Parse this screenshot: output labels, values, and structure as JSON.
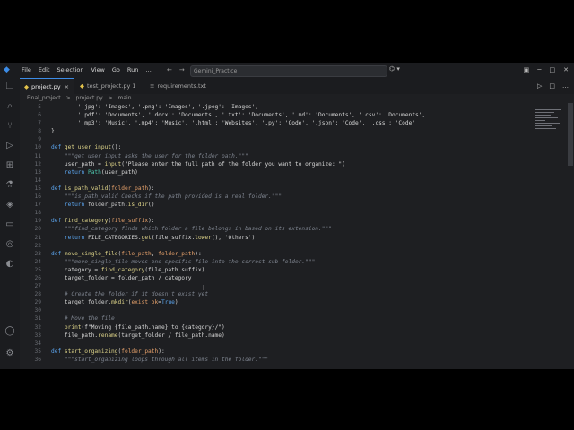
{
  "menu": [
    "File",
    "Edit",
    "Selection",
    "View",
    "Go",
    "Run",
    "…"
  ],
  "search": {
    "value": "Gemini_Practice"
  },
  "tabs": [
    {
      "label": "project.py",
      "active": true,
      "close": "×"
    },
    {
      "label": "test_project.py 1",
      "active": false,
      "close": ""
    },
    {
      "label": "requirements.txt",
      "active": false,
      "close": ""
    }
  ],
  "breadcrumbs": [
    "Final_project",
    ">",
    "project.py",
    ">",
    "main"
  ],
  "lines": [
    {
      "n": "5",
      "tokens": [
        {
          "t": "        "
        },
        {
          "t": "'.jpg': 'Images', '.png': 'Images', '.jpeg': 'Images',",
          "c": "st"
        }
      ]
    },
    {
      "n": "6",
      "tokens": [
        {
          "t": "        "
        },
        {
          "t": "'.pdf': 'Documents', '.docx': 'Documents', '.txt': 'Documents', '.md': 'Documents', '.csv': 'Documents',",
          "c": "st"
        }
      ]
    },
    {
      "n": "7",
      "tokens": [
        {
          "t": "        "
        },
        {
          "t": "'.mp3': 'Music', '.mp4': 'Music', '.html': 'Websites', '.py': 'Code', '.json': 'Code', '.css': 'Code'",
          "c": "st"
        }
      ]
    },
    {
      "n": "8",
      "tokens": [
        {
          "t": "}"
        }
      ]
    },
    {
      "n": "9",
      "tokens": []
    },
    {
      "n": "10",
      "tokens": [
        {
          "t": "def ",
          "c": "kw"
        },
        {
          "t": "get_user_input",
          "c": "fn"
        },
        {
          "t": "():"
        }
      ]
    },
    {
      "n": "11",
      "tokens": [
        {
          "t": "    "
        },
        {
          "t": "\"\"\"get_user_input asks the user for the folder path.\"\"\"",
          "c": "dc"
        }
      ]
    },
    {
      "n": "12",
      "tokens": [
        {
          "t": "    user_path = "
        },
        {
          "t": "input",
          "c": "fn"
        },
        {
          "t": "("
        },
        {
          "t": "\"Please enter the full path of the folder you want to organize: \"",
          "c": "st"
        },
        {
          "t": ")"
        }
      ]
    },
    {
      "n": "13",
      "tokens": [
        {
          "t": "    "
        },
        {
          "t": "return ",
          "c": "kw"
        },
        {
          "t": "Path",
          "c": "bi"
        },
        {
          "t": "(user_path)"
        }
      ]
    },
    {
      "n": "14",
      "tokens": []
    },
    {
      "n": "15",
      "tokens": [
        {
          "t": "def ",
          "c": "kw"
        },
        {
          "t": "is_path_valid",
          "c": "fn"
        },
        {
          "t": "("
        },
        {
          "t": "folder_path",
          "c": "pa"
        },
        {
          "t": "):"
        }
      ]
    },
    {
      "n": "16",
      "tokens": [
        {
          "t": "    "
        },
        {
          "t": "\"\"\"is_path_valid Checks if the path provided is a real folder.\"\"\"",
          "c": "dc"
        }
      ]
    },
    {
      "n": "17",
      "tokens": [
        {
          "t": "    "
        },
        {
          "t": "return ",
          "c": "kw"
        },
        {
          "t": "folder_path."
        },
        {
          "t": "is_dir",
          "c": "fn"
        },
        {
          "t": "()"
        }
      ]
    },
    {
      "n": "18",
      "tokens": []
    },
    {
      "n": "19",
      "tokens": [
        {
          "t": "def ",
          "c": "kw"
        },
        {
          "t": "find_category",
          "c": "fn"
        },
        {
          "t": "("
        },
        {
          "t": "file_suffix",
          "c": "pa"
        },
        {
          "t": "):"
        }
      ]
    },
    {
      "n": "20",
      "tokens": [
        {
          "t": "    "
        },
        {
          "t": "\"\"\"find_category finds which folder a file belongs in based on its extension.\"\"\"",
          "c": "dc"
        }
      ]
    },
    {
      "n": "21",
      "tokens": [
        {
          "t": "    "
        },
        {
          "t": "return ",
          "c": "kw"
        },
        {
          "t": "FILE_CATEGORIES."
        },
        {
          "t": "get",
          "c": "fn"
        },
        {
          "t": "(file_suffix."
        },
        {
          "t": "lower",
          "c": "fn"
        },
        {
          "t": "(), "
        },
        {
          "t": "'Others'",
          "c": "st"
        },
        {
          "t": ")"
        }
      ]
    },
    {
      "n": "22",
      "tokens": []
    },
    {
      "n": "23",
      "tokens": [
        {
          "t": "def ",
          "c": "kw"
        },
        {
          "t": "move_single_file",
          "c": "fn"
        },
        {
          "t": "("
        },
        {
          "t": "file_path",
          "c": "pa"
        },
        {
          "t": ", "
        },
        {
          "t": "folder_path",
          "c": "pa"
        },
        {
          "t": "):"
        }
      ]
    },
    {
      "n": "24",
      "tokens": [
        {
          "t": "    "
        },
        {
          "t": "\"\"\"move_single_file moves one specific file into the correct sub-folder.\"\"\"",
          "c": "dc"
        }
      ]
    },
    {
      "n": "25",
      "tokens": [
        {
          "t": "    category = "
        },
        {
          "t": "find_category",
          "c": "fn"
        },
        {
          "t": "(file_path.suffix)"
        }
      ]
    },
    {
      "n": "26",
      "tokens": [
        {
          "t": "    target_folder = folder_path / category"
        }
      ]
    },
    {
      "n": "27",
      "tokens": []
    },
    {
      "n": "28",
      "tokens": [
        {
          "t": "    "
        },
        {
          "t": "# Create the folder if it doesn't exist yet",
          "c": "cm"
        }
      ]
    },
    {
      "n": "29",
      "tokens": [
        {
          "t": "    target_folder."
        },
        {
          "t": "mkdir",
          "c": "fn"
        },
        {
          "t": "("
        },
        {
          "t": "exist_ok",
          "c": "pa"
        },
        {
          "t": "="
        },
        {
          "t": "True",
          "c": "bo"
        },
        {
          "t": ")"
        }
      ]
    },
    {
      "n": "30",
      "tokens": []
    },
    {
      "n": "31",
      "tokens": [
        {
          "t": "    "
        },
        {
          "t": "# Move the file",
          "c": "cm"
        }
      ]
    },
    {
      "n": "32",
      "tokens": [
        {
          "t": "    "
        },
        {
          "t": "print",
          "c": "fn"
        },
        {
          "t": "("
        },
        {
          "t": "f\"Moving {file_path.name} to {category}/\"",
          "c": "st"
        },
        {
          "t": ")"
        }
      ]
    },
    {
      "n": "33",
      "tokens": [
        {
          "t": "    file_path."
        },
        {
          "t": "rename",
          "c": "fn"
        },
        {
          "t": "(target_folder / file_path.name)"
        }
      ]
    },
    {
      "n": "34",
      "tokens": []
    },
    {
      "n": "35",
      "tokens": [
        {
          "t": "def ",
          "c": "kw"
        },
        {
          "t": "start_organizing",
          "c": "fn"
        },
        {
          "t": "("
        },
        {
          "t": "folder_path",
          "c": "pa"
        },
        {
          "t": "):"
        }
      ]
    },
    {
      "n": "36",
      "tokens": [
        {
          "t": "    "
        },
        {
          "t": "\"\"\"start_organizing loops through all items in the folder.\"\"\"",
          "c": "dc"
        }
      ]
    }
  ],
  "icons": {
    "app": "vscode-icon",
    "activity": [
      "explorer-icon",
      "search-icon",
      "source-control-icon",
      "run-debug-icon",
      "extensions-icon",
      "testing-icon",
      "python-icon",
      "remote-icon",
      "chat-icon",
      "docker-icon"
    ],
    "activity_bottom": [
      "account-icon",
      "settings-icon"
    ]
  },
  "colors": {
    "accent": "#3c8ce7",
    "keyword": "#5aa3ec",
    "function": "#e0d68a",
    "docstring": "#7f8590"
  }
}
